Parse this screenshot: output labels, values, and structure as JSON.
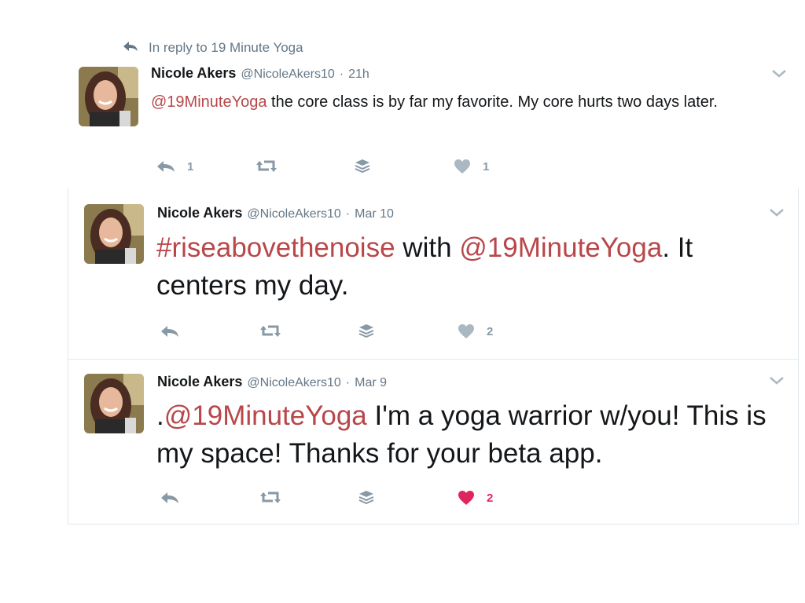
{
  "reply_context": {
    "text": "In reply to 19 Minute Yoga"
  },
  "tweets": [
    {
      "name": "Nicole Akers",
      "handle": "@NicoleAkers10",
      "time": "21h",
      "mention": "@19MinuteYoga",
      "text_1": " the core class is by far my favorite. My core hurts two days later.",
      "reply_count": "1",
      "retweet_count": "",
      "like_count": "1",
      "liked": false
    },
    {
      "name": "Nicole Akers",
      "handle": "@NicoleAkers10",
      "time": "Mar 10",
      "hashtag": "#riseabovethenoise",
      "text_1": " with ",
      "mention": "@19MinuteYoga",
      "text_2": ". It centers my day.",
      "reply_count": "",
      "retweet_count": "",
      "like_count": "2",
      "liked": false
    },
    {
      "name": "Nicole Akers",
      "handle": "@NicoleAkers10",
      "time": "Mar 9",
      "prefix": ".",
      "mention": "@19MinuteYoga",
      "text_1": " I'm a yoga warrior w/you! This is my space! Thanks for your beta app.",
      "reply_count": "",
      "retweet_count": "",
      "like_count": "2",
      "liked": true
    }
  ],
  "meta_separator": " · ",
  "icons": {
    "reply": "reply-icon",
    "retweet": "retweet-icon",
    "stack": "stack-icon",
    "like": "heart-icon",
    "caret": "chevron-down-icon"
  },
  "colors": {
    "link": "#b8474a",
    "muted": "#8899a6",
    "liked": "#e0245e",
    "border": "#e1e8ed"
  }
}
